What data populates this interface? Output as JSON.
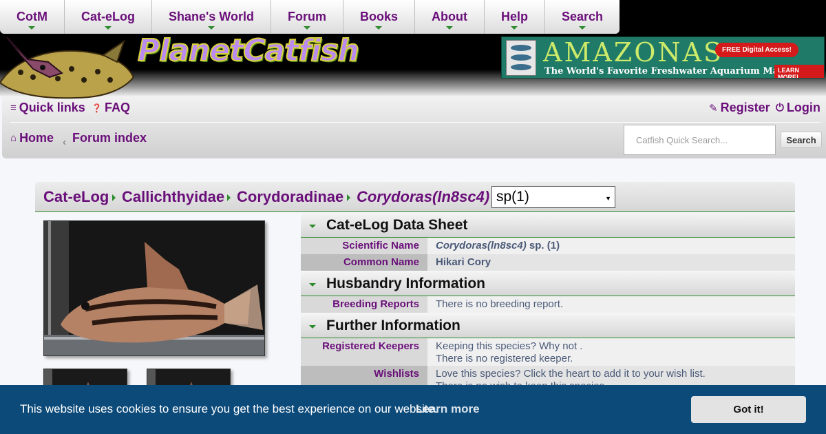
{
  "nav": {
    "items": [
      "CotM",
      "Cat-eLog",
      "Shane's World",
      "Forum",
      "Books",
      "About",
      "Help",
      "Search"
    ]
  },
  "header": {
    "logo_text": "PlanetCatfish",
    "ad": {
      "brand": "AMAZONAS",
      "tagline": "The World's Favorite Freshwater Aquarium Magazine!",
      "free_badge": "FREE Digital Access!",
      "learn_more": "LEARN MORE!"
    }
  },
  "links": {
    "quick_links": "Quick links",
    "faq": "FAQ",
    "register": "Register",
    "login": "Login",
    "home": "Home",
    "crumb_sep": "‹",
    "forum_index": "Forum index",
    "search_placeholder": "Catfish Quick Search...",
    "search_button": "Search"
  },
  "breadcrumb": {
    "items": [
      "Cat-eLog",
      "Callichthyidae",
      "Corydoradinae",
      "Corydoras(ln8sc4)"
    ],
    "species_select": "sp(1)"
  },
  "sections": {
    "datasheet_title": "Cat-eLog Data Sheet",
    "husbandry_title": "Husbandry Information",
    "further_title": "Further Information"
  },
  "rows": {
    "scientific_name_label": "Scientific Name",
    "scientific_genus": "Corydoras(ln8sc4)",
    "scientific_species": "sp. (1)",
    "common_name_label": "Common Name",
    "common_name": "Hikari Cory",
    "breeding_label": "Breeding Reports",
    "breeding_value": "There is no breeding report.",
    "keepers_label": "Registered Keepers",
    "keepers_line1": "Keeping this species? Why not .",
    "keepers_line2": "There is no registered keeper.",
    "wishlists_label": "Wishlists",
    "wishlists_line1": "Love this species? Click the heart to add it to your wish list.",
    "wishlists_line2": "There is no wish to keep this species."
  },
  "cookie": {
    "message": "This website uses cookies to ensure you get the best experience on our website.",
    "learn_more": "Learn more",
    "button": "Got it!"
  },
  "colors": {
    "link_purple": "#6a0f7a",
    "accent_green": "#2e8b2e",
    "cookie_blue": "#0c4a7a"
  }
}
